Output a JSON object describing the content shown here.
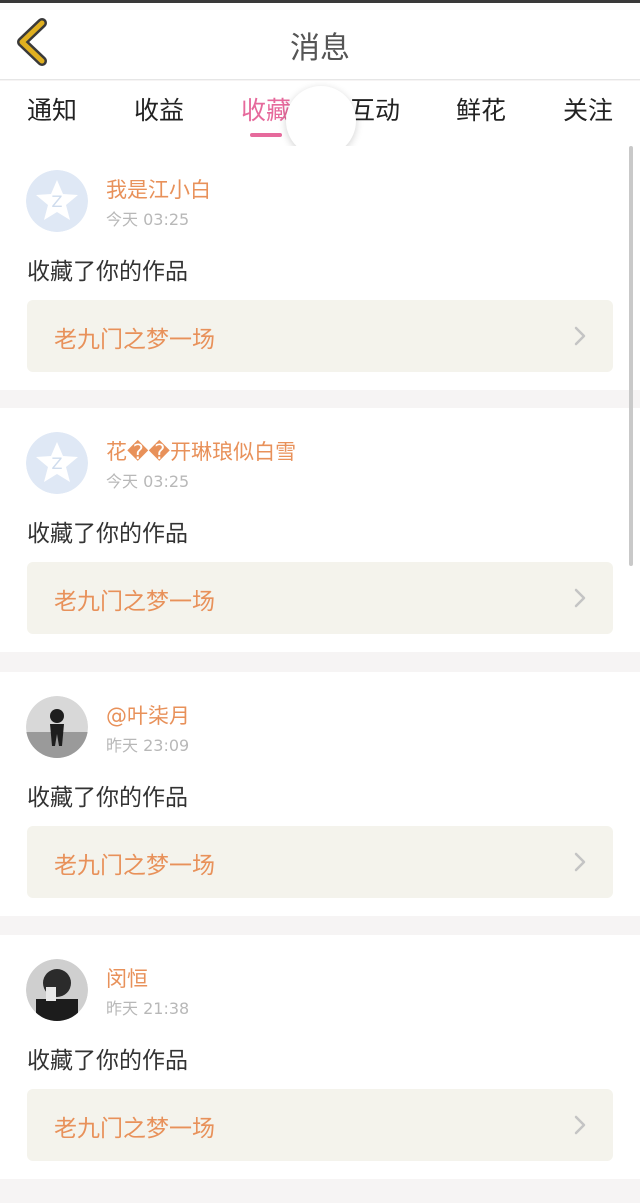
{
  "header": {
    "title": "消息",
    "back_icon": "chevron-left-icon"
  },
  "tabs": [
    {
      "label": "通知",
      "active": false
    },
    {
      "label": "收益",
      "active": false
    },
    {
      "label": "收藏",
      "active": true
    },
    {
      "label": "互动",
      "active": false
    },
    {
      "label": "鲜花",
      "active": false
    },
    {
      "label": "关注",
      "active": false
    }
  ],
  "notifications": [
    {
      "username": "我是江小白",
      "time": "今天 03:25",
      "action": "收藏了你的作品",
      "work": "老九门之梦一场",
      "avatar": "default-avatar"
    },
    {
      "username": "花��开琳琅似白雪",
      "time": "今天 03:25",
      "action": "收藏了你的作品",
      "work": "老九门之梦一场",
      "avatar": "default-avatar"
    },
    {
      "username": "@叶柒月",
      "time": "昨天 23:09",
      "action": "收藏了你的作品",
      "work": "老九门之梦一场",
      "avatar": "photo-avatar"
    },
    {
      "username": "闵恒",
      "time": "昨天 21:38",
      "action": "收藏了你的作品",
      "work": "老九门之梦一场",
      "avatar": "photo-avatar"
    }
  ],
  "colors": {
    "accent": "#e66a9c",
    "username": "#e8915a",
    "back_icon": "#e0b020"
  }
}
